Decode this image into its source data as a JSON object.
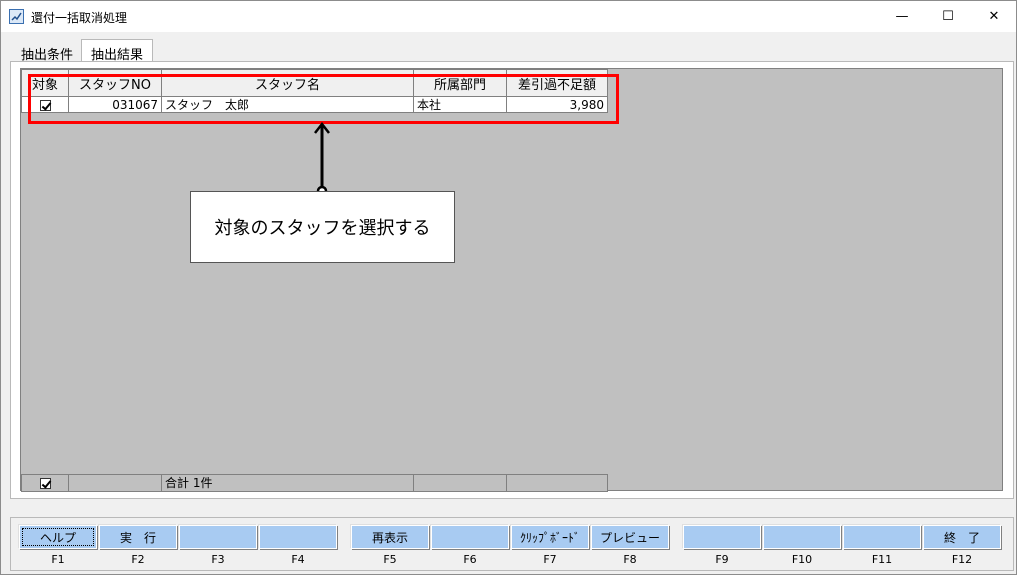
{
  "window": {
    "title": "還付一括取消処理",
    "min_glyph": "—",
    "max_glyph": "☐",
    "close_glyph": "✕"
  },
  "tabs": [
    {
      "label": "抽出条件",
      "active": false
    },
    {
      "label": "抽出結果",
      "active": true
    }
  ],
  "grid": {
    "columns": [
      "対象",
      "スタッフNO",
      "スタッフ名",
      "所属部門",
      "差引過不足額"
    ],
    "rows": [
      {
        "checked": true,
        "staff_no": "031067",
        "staff_name": "スタッフ　太郎",
        "department": "本社",
        "amount": "3,980"
      }
    ],
    "total": {
      "checked": true,
      "label": "合計 1件"
    }
  },
  "callout": {
    "text": "対象のスタッフを選択する"
  },
  "fkeys": [
    {
      "label": "ヘルプ",
      "key": "F1",
      "focused": true
    },
    {
      "label": "実　行",
      "key": "F2"
    },
    {
      "label": "",
      "key": "F3"
    },
    {
      "label": "",
      "key": "F4"
    },
    {
      "label": "再表示",
      "key": "F5"
    },
    {
      "label": "",
      "key": "F6"
    },
    {
      "label": "ｸﾘｯﾌﾟﾎﾞｰﾄﾞ",
      "key": "F7"
    },
    {
      "label": "プレビュー",
      "key": "F8"
    },
    {
      "label": "",
      "key": "F9"
    },
    {
      "label": "",
      "key": "F10"
    },
    {
      "label": "",
      "key": "F11"
    },
    {
      "label": "終　了",
      "key": "F12"
    }
  ],
  "colors": {
    "highlight": "#ff0000",
    "fkey_bg": "#a8cbf2",
    "grid_bg": "#c0c0c0"
  }
}
